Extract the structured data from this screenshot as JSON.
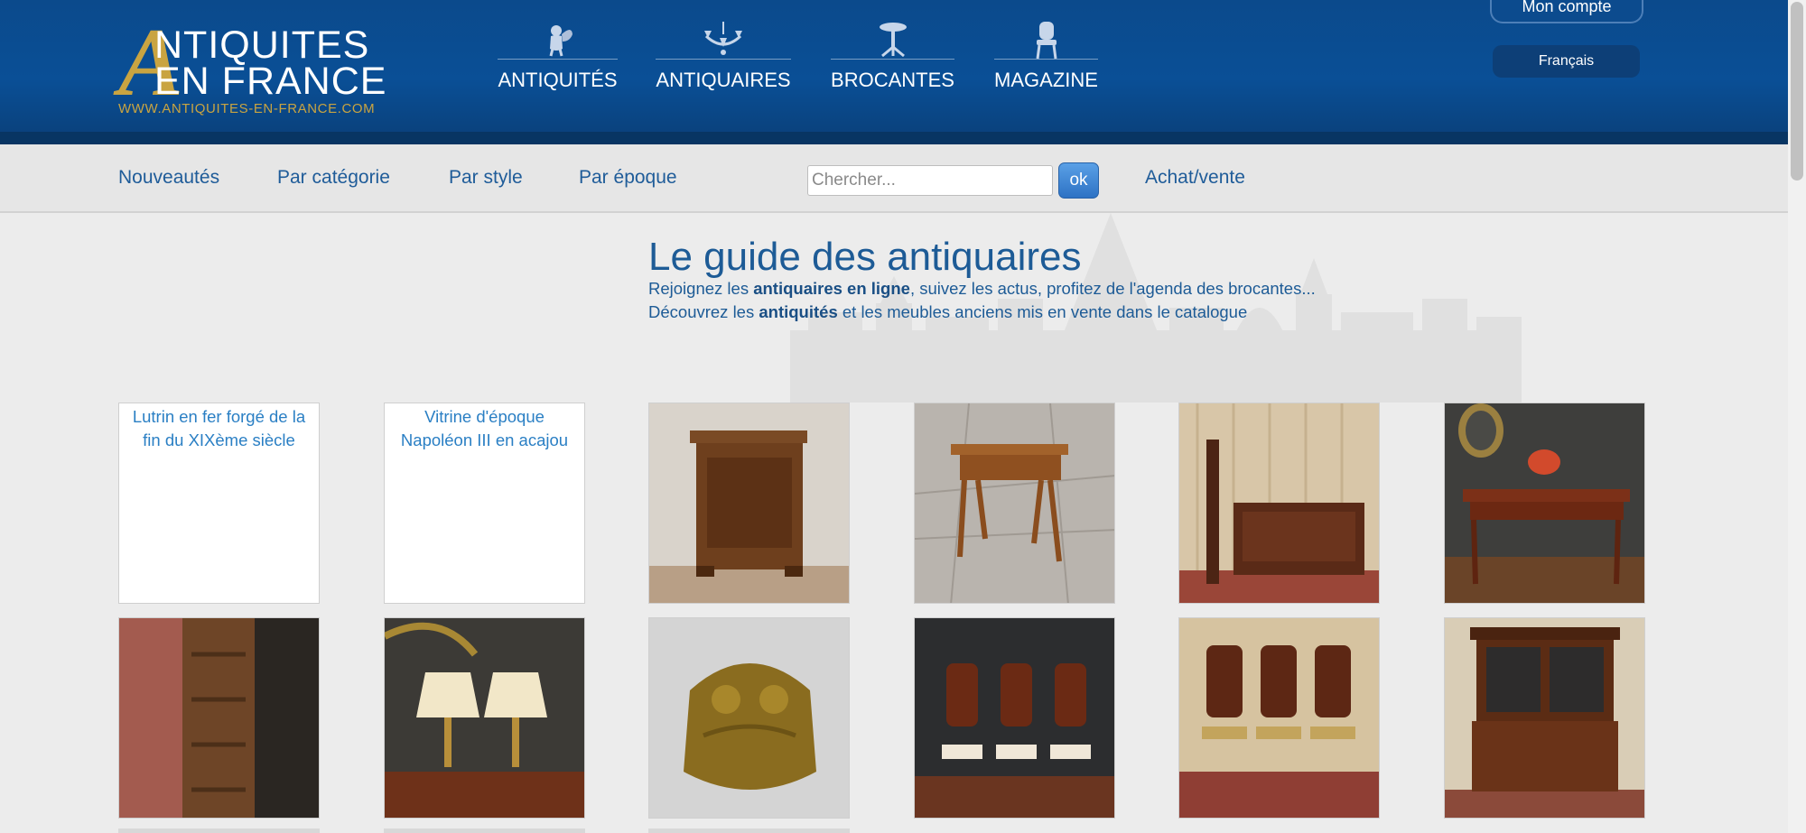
{
  "header": {
    "logo": {
      "big_letter": "A",
      "line1": "NTIQUITES",
      "line2": "EN FRANCE",
      "url": "WWW.ANTIQUITES-EN-FRANCE.COM"
    },
    "main_nav": [
      {
        "label": "ANTIQUITÉS",
        "icon": "cherub-icon"
      },
      {
        "label": "ANTIQUAIRES",
        "icon": "chandelier-icon"
      },
      {
        "label": "BROCANTES",
        "icon": "pedestal-table-icon"
      },
      {
        "label": "MAGAZINE",
        "icon": "chair-icon"
      }
    ],
    "account_label": "Mon compte",
    "language_label": "Français"
  },
  "subnav": {
    "links": [
      "Nouveautés",
      "Par catégorie",
      "Par style",
      "Par époque"
    ],
    "search_placeholder": "Chercher...",
    "search_button": "ok",
    "buy_sell": "Achat/vente"
  },
  "hero": {
    "title": "Le guide des antiquaires",
    "line1_pre": "Rejoignez les ",
    "line1_bold": "antiquaires en ligne",
    "line1_post": ", suivez les actus, profitez de l'agenda des brocantes...",
    "line2_pre": "Découvrez les ",
    "line2_bold": "antiquités",
    "line2_post": " et les meubles anciens mis en vente dans le catalogue"
  },
  "catalogue": {
    "broken_images": [
      "Lutrin en fer forgé de la fin du XIXème siècle",
      "Vitrine d'époque Napoléon III en acajou"
    ],
    "photos": [
      "walnut-nightstand-photo",
      "cherry-side-table-photo",
      "mahogany-bed-photo",
      "mahogany-desk-photo",
      "armoire-interior-photo",
      "pair-of-lamps-photo",
      "brass-owl-photo",
      "six-mahogany-chairs-photo",
      "four-cane-chairs-photo",
      "mahogany-buffet-photo"
    ]
  },
  "colors": {
    "header_blue": "#0a4f96",
    "gold": "#c9a441",
    "link_blue": "#1f5c99",
    "button_blue": "#2d72c4"
  }
}
